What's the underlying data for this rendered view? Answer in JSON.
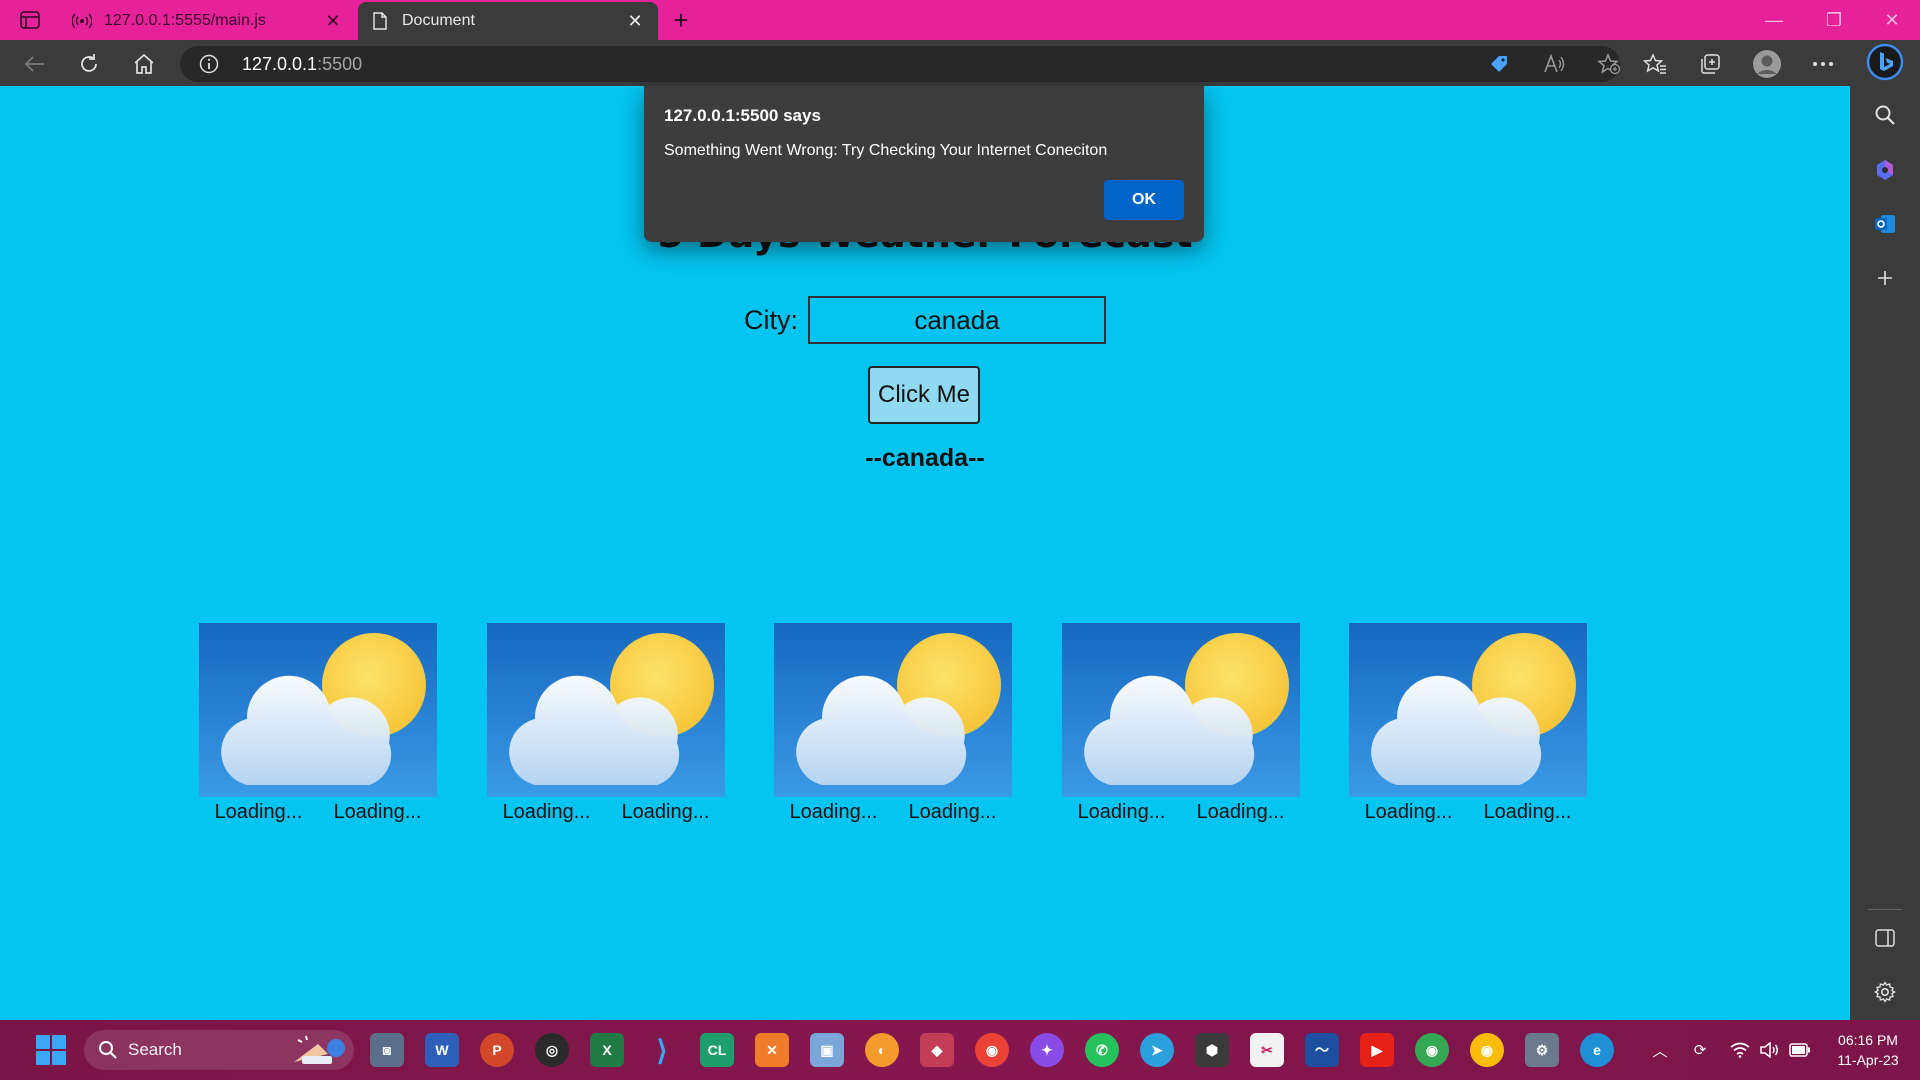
{
  "browser": {
    "tabs": [
      {
        "title": "127.0.0.1:5555/main.js",
        "active": false
      },
      {
        "title": "Document",
        "active": true
      }
    ],
    "address": {
      "host": "127.0.0.1",
      "port": ":5500"
    },
    "colors": {
      "frame": "#e6219a",
      "toolbar": "#3b3b3b"
    }
  },
  "page": {
    "heading": "5 Days Weather Forecast",
    "city_label": "City:",
    "city_value": "canada",
    "button_label": "Click Me",
    "city_output": "--canada--",
    "background": "#04c5f1",
    "forecast": [
      {
        "min": "Loading...",
        "max": "Loading..."
      },
      {
        "min": "Loading...",
        "max": "Loading..."
      },
      {
        "min": "Loading...",
        "max": "Loading..."
      },
      {
        "min": "Loading...",
        "max": "Loading..."
      },
      {
        "min": "Loading...",
        "max": "Loading..."
      }
    ]
  },
  "dialog": {
    "title": "127.0.0.1:5500 says",
    "message": "Something Went Wrong: Try Checking Your Internet Coneciton",
    "ok_label": "OK"
  },
  "taskbar": {
    "search_label": "Search",
    "time": "06:16 PM",
    "date": "11-Apr-23"
  }
}
